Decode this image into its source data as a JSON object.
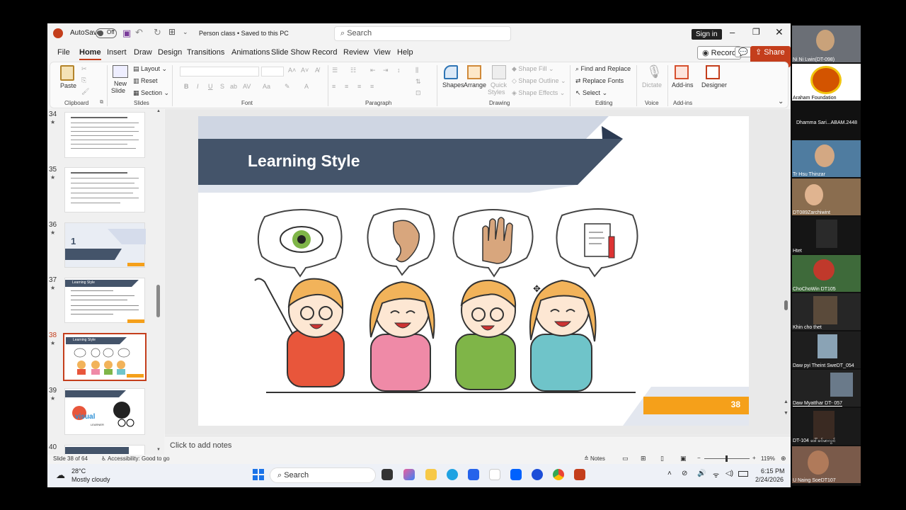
{
  "titlebar": {
    "autosave_label": "AutoSave",
    "autosave_state": "Off",
    "doc_title": "Person class • Saved to this PC",
    "search_placeholder": "Search",
    "signin": "Sign in"
  },
  "menu": {
    "items": [
      "File",
      "Home",
      "Insert",
      "Draw",
      "Design",
      "Transitions",
      "Animations",
      "Slide Show",
      "Record",
      "Review",
      "View",
      "Help"
    ],
    "record": "Record",
    "share": "Share"
  },
  "ribbon": {
    "clipboard": {
      "paste": "Paste",
      "group": "Clipboard"
    },
    "slides": {
      "new_slide_1": "New",
      "new_slide_2": "Slide",
      "layout": "Layout",
      "reset": "Reset",
      "section": "Section",
      "group": "Slides"
    },
    "font": {
      "group": "Font"
    },
    "paragraph": {
      "group": "Paragraph"
    },
    "drawing": {
      "shapes": "Shapes",
      "arrange": "Arrange",
      "quick1": "Quick",
      "quick2": "Styles",
      "fill": "Shape Fill",
      "outline": "Shape Outline",
      "effects": "Shape Effects",
      "group": "Drawing"
    },
    "editing": {
      "find": "Find and Replace",
      "replace": "Replace Fonts",
      "select": "Select",
      "group": "Editing"
    },
    "voice": {
      "dictate": "Dictate",
      "group": "Voice"
    },
    "addins": {
      "addins": "Add-ins",
      "designer": "Designer",
      "group": "Add-ins"
    }
  },
  "thumbnails": [
    {
      "num": "34"
    },
    {
      "num": "35"
    },
    {
      "num": "36",
      "big": "1"
    },
    {
      "num": "37",
      "title": "Learning Style"
    },
    {
      "num": "38",
      "title": "Learning Style",
      "selected": true
    },
    {
      "num": "39",
      "label": "LEARNER"
    },
    {
      "num": "40"
    }
  ],
  "slide": {
    "title": "Learning Style",
    "page_number": "38"
  },
  "notes": {
    "placeholder": "Click to add notes"
  },
  "status": {
    "slide_of": "Slide 38 of 64",
    "accessibility": "Accessibility: Good to go",
    "notes": "Notes",
    "zoom": "119%"
  },
  "taskbar": {
    "temp": "28°C",
    "weather": "Mostly cloudy",
    "search": "Search",
    "time": "6:15 PM",
    "date": "2/24/2026"
  },
  "participants": [
    "Ni Ni Lwin(DT-098)",
    "Araham Foundation",
    "Dhamma Sari...ABAM.2448",
    "Tr Hsu Thinzar",
    "DT089Zarchiwint",
    "Htet",
    "ChoChoWin DT105",
    "Khin cho thet",
    "Daw pyi Theint SweDT_054",
    "Daw Myatthar DT- 057",
    "DT-104 ဒေါ်ခင်မာလွင်",
    "U Naing SoeDT107"
  ],
  "colors": {
    "accent": "#c43e1c",
    "banner": "#44546a",
    "orange": "#f5a01a"
  }
}
